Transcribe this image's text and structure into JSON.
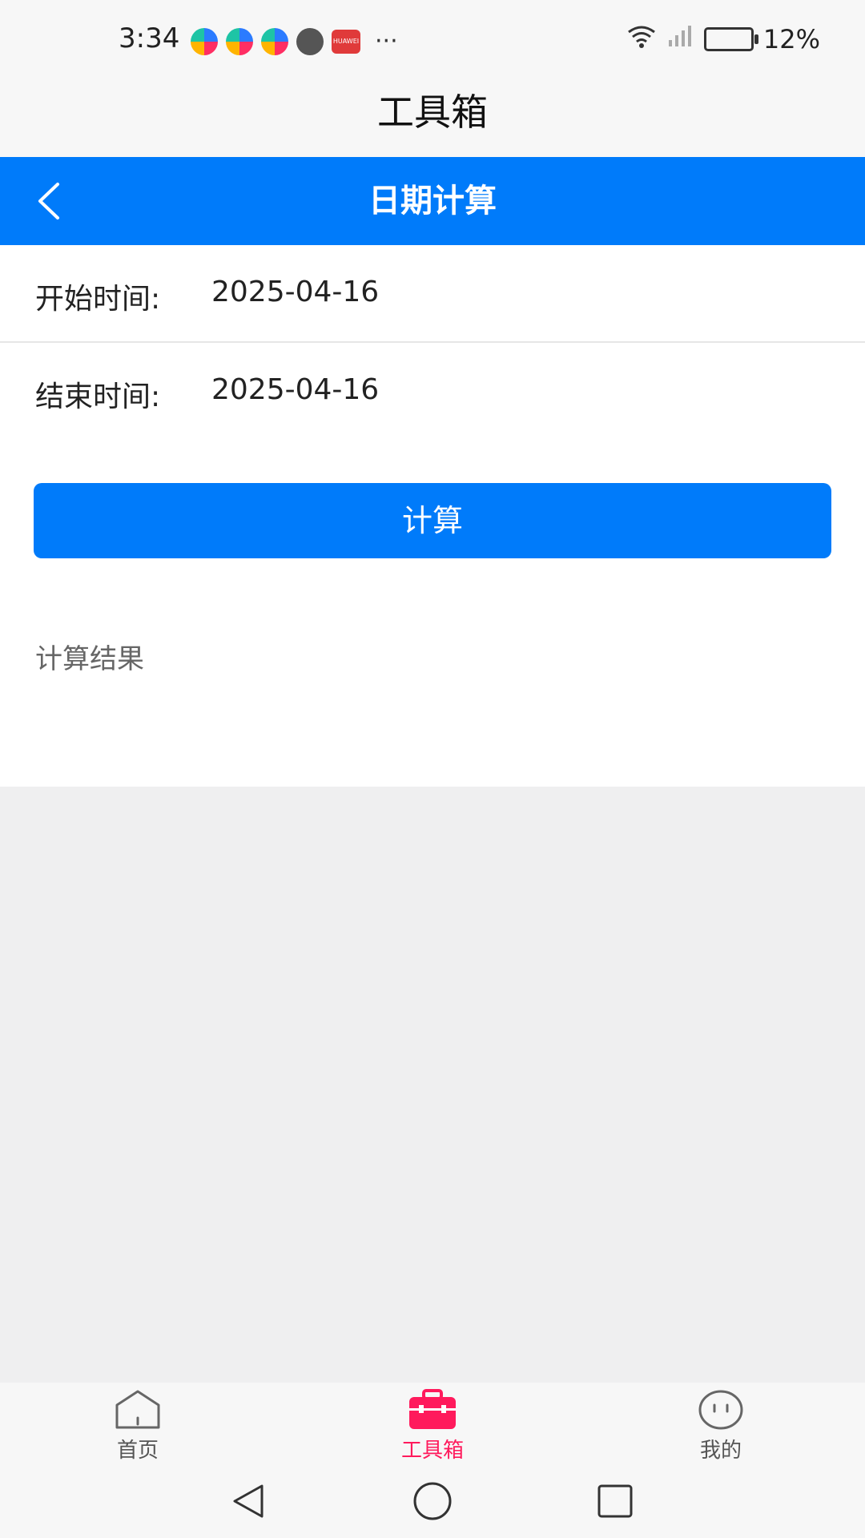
{
  "status_bar": {
    "time": "3:34",
    "battery": "12%"
  },
  "app_title": "工具箱",
  "nav": {
    "title": "日期计算"
  },
  "form": {
    "start_label": "开始时间:",
    "start_value": "2025-04-16",
    "end_label": "结束时间:",
    "end_value": "2025-04-16",
    "calculate_button": "计算"
  },
  "result": {
    "label": "计算结果"
  },
  "tabbar": {
    "items": [
      {
        "label": "首页",
        "icon": "home-icon",
        "active": false
      },
      {
        "label": "工具箱",
        "icon": "toolbox-icon",
        "active": true
      },
      {
        "label": "我的",
        "icon": "face-icon",
        "active": false
      }
    ]
  },
  "colors": {
    "primary": "#007bfa",
    "tab_active": "#ff1a5c",
    "background_gray": "#efeff0"
  }
}
